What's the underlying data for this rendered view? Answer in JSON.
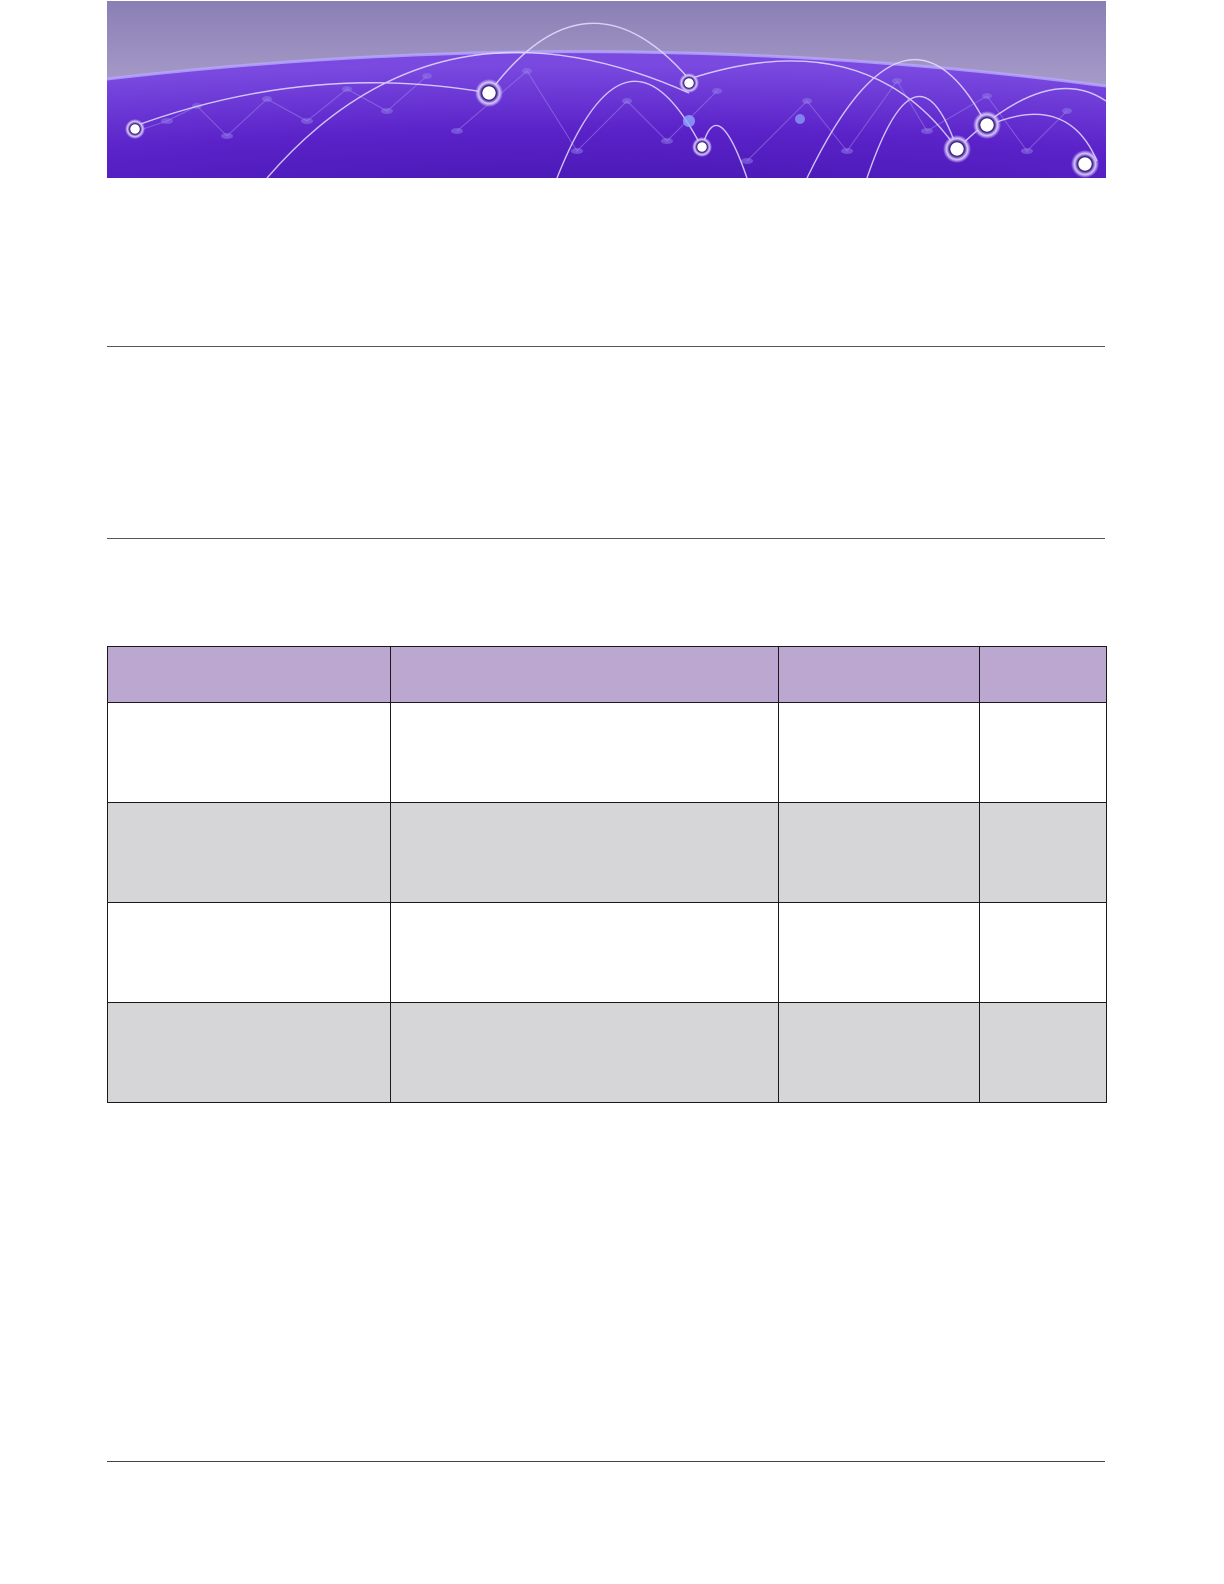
{
  "colors": {
    "banner_purple": "#5a22c8",
    "banner_sky": "#8a7fb4",
    "header_fill": "#bba7cf",
    "shaded_row_fill": "#d6d6d8",
    "rule_color": "#555555"
  },
  "banner": {
    "icon": "network-globe-banner"
  },
  "table": {
    "headers": [
      "",
      "",
      "",
      ""
    ],
    "rows": [
      [
        "",
        "",
        "",
        ""
      ],
      [
        "",
        "",
        "",
        ""
      ],
      [
        "",
        "",
        "",
        ""
      ],
      [
        "",
        "",
        "",
        ""
      ]
    ]
  }
}
